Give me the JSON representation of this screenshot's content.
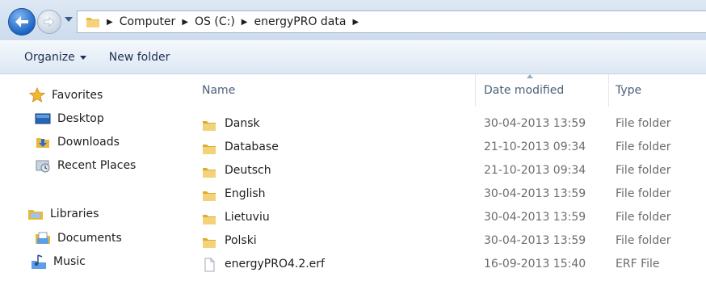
{
  "address_bar": {
    "crumbs": [
      "Computer",
      "OS (C:)",
      "energyPRO data"
    ]
  },
  "toolbar": {
    "organize_label": "Organize",
    "new_folder_label": "New folder"
  },
  "nav_pane": {
    "favorites": {
      "label": "Favorites",
      "icon": "star-icon"
    },
    "favorite_items": [
      {
        "label": "Desktop",
        "icon": "desktop-icon"
      },
      {
        "label": "Downloads",
        "icon": "downloads-icon"
      },
      {
        "label": "Recent Places",
        "icon": "recent-places-icon"
      }
    ],
    "libraries": {
      "label": "Libraries",
      "icon": "libraries-icon"
    },
    "library_items": [
      {
        "label": "Documents",
        "icon": "documents-icon"
      },
      {
        "label": "Music",
        "icon": "music-icon"
      }
    ]
  },
  "columns": {
    "name": "Name",
    "date_modified": "Date modified",
    "type": "Type"
  },
  "files": [
    {
      "name": "Dansk",
      "date": "30-04-2013 13:59",
      "type": "File folder",
      "icon": "folder-icon"
    },
    {
      "name": "Database",
      "date": "21-10-2013 09:34",
      "type": "File folder",
      "icon": "folder-icon"
    },
    {
      "name": "Deutsch",
      "date": "21-10-2013 09:34",
      "type": "File folder",
      "icon": "folder-icon"
    },
    {
      "name": "English",
      "date": "30-04-2013 13:59",
      "type": "File folder",
      "icon": "folder-icon"
    },
    {
      "name": "Lietuviu",
      "date": "30-04-2013 13:59",
      "type": "File folder",
      "icon": "folder-icon"
    },
    {
      "name": "Polski",
      "date": "30-04-2013 13:59",
      "type": "File folder",
      "icon": "folder-icon"
    },
    {
      "name": "energyPRO4.2.erf",
      "date": "16-09-2013 15:40",
      "type": "ERF File",
      "icon": "file-icon"
    }
  ],
  "colors": {
    "folder": "#e8b83a",
    "accent_blue": "#1d66c4"
  }
}
